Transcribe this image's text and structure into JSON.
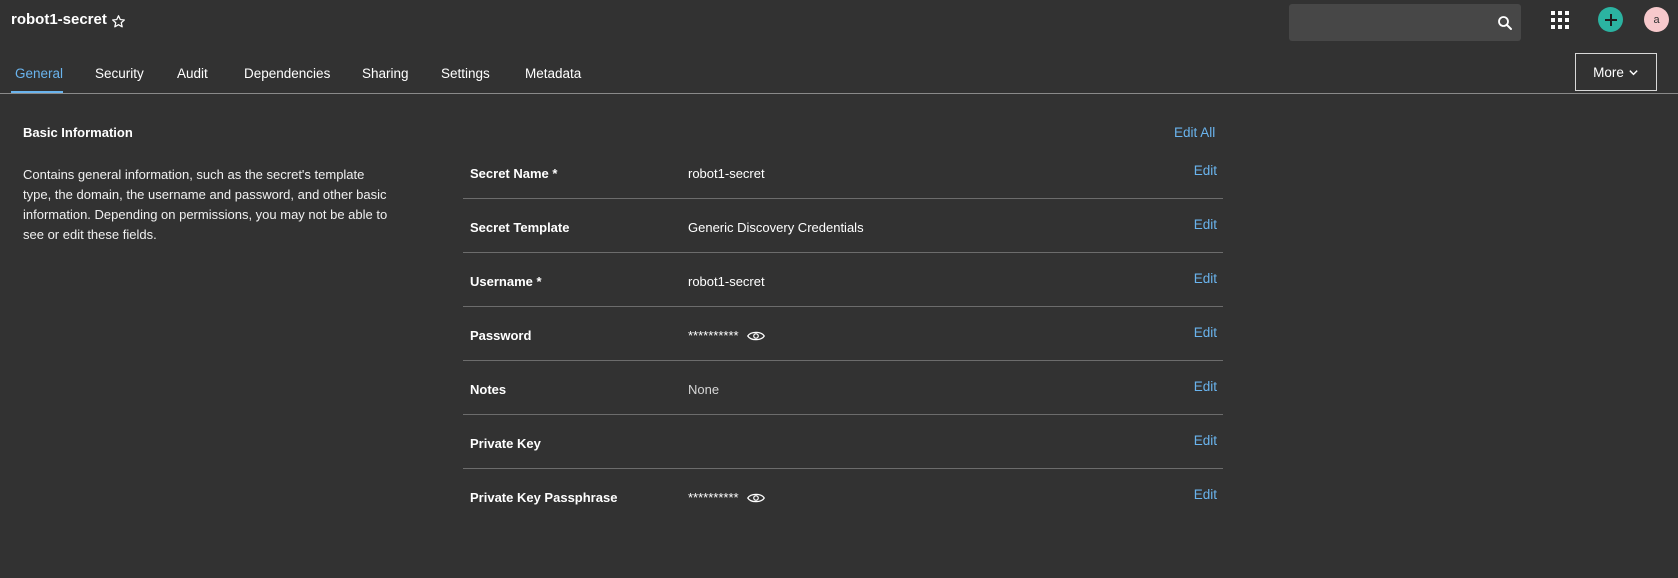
{
  "header": {
    "title": "robot1-secret",
    "search_placeholder": "",
    "avatar_initial": "a"
  },
  "tabs": [
    {
      "label": "General",
      "active": true
    },
    {
      "label": "Security"
    },
    {
      "label": "Audit"
    },
    {
      "label": "Dependencies"
    },
    {
      "label": "Sharing"
    },
    {
      "label": "Settings"
    },
    {
      "label": "Metadata"
    }
  ],
  "more_label": "More",
  "section": {
    "title": "Basic Information",
    "description": "Contains general information, such as the secret's template type, the domain, the username and password, and other basic information. Depending on permissions, you may not be able to see or edit these fields.",
    "edit_all_label": "Edit All"
  },
  "fields": [
    {
      "label": "Secret Name *",
      "value": "robot1-secret",
      "edit": "Edit"
    },
    {
      "label": "Secret Template",
      "value": "Generic Discovery Credentials",
      "edit": "Edit"
    },
    {
      "label": "Username *",
      "value": "robot1-secret",
      "edit": "Edit"
    },
    {
      "label": "Password",
      "value": "**********",
      "edit": "Edit"
    },
    {
      "label": "Notes",
      "value": "None",
      "edit": "Edit"
    },
    {
      "label": "Private Key",
      "value": "",
      "edit": "Edit"
    },
    {
      "label": "Private Key Passphrase",
      "value": "**********",
      "edit": "Edit"
    }
  ],
  "colors": {
    "background": "#323232",
    "accent": "#6ab4ee",
    "add_button": "#2bb3a1",
    "avatar": "#f7c9cc"
  },
  "icons": {
    "favorite": "star-outline-icon",
    "search": "search-icon",
    "apps": "grid-icon",
    "add": "plus-icon",
    "reveal": "eye-icon",
    "more": "chevron-down-icon"
  }
}
